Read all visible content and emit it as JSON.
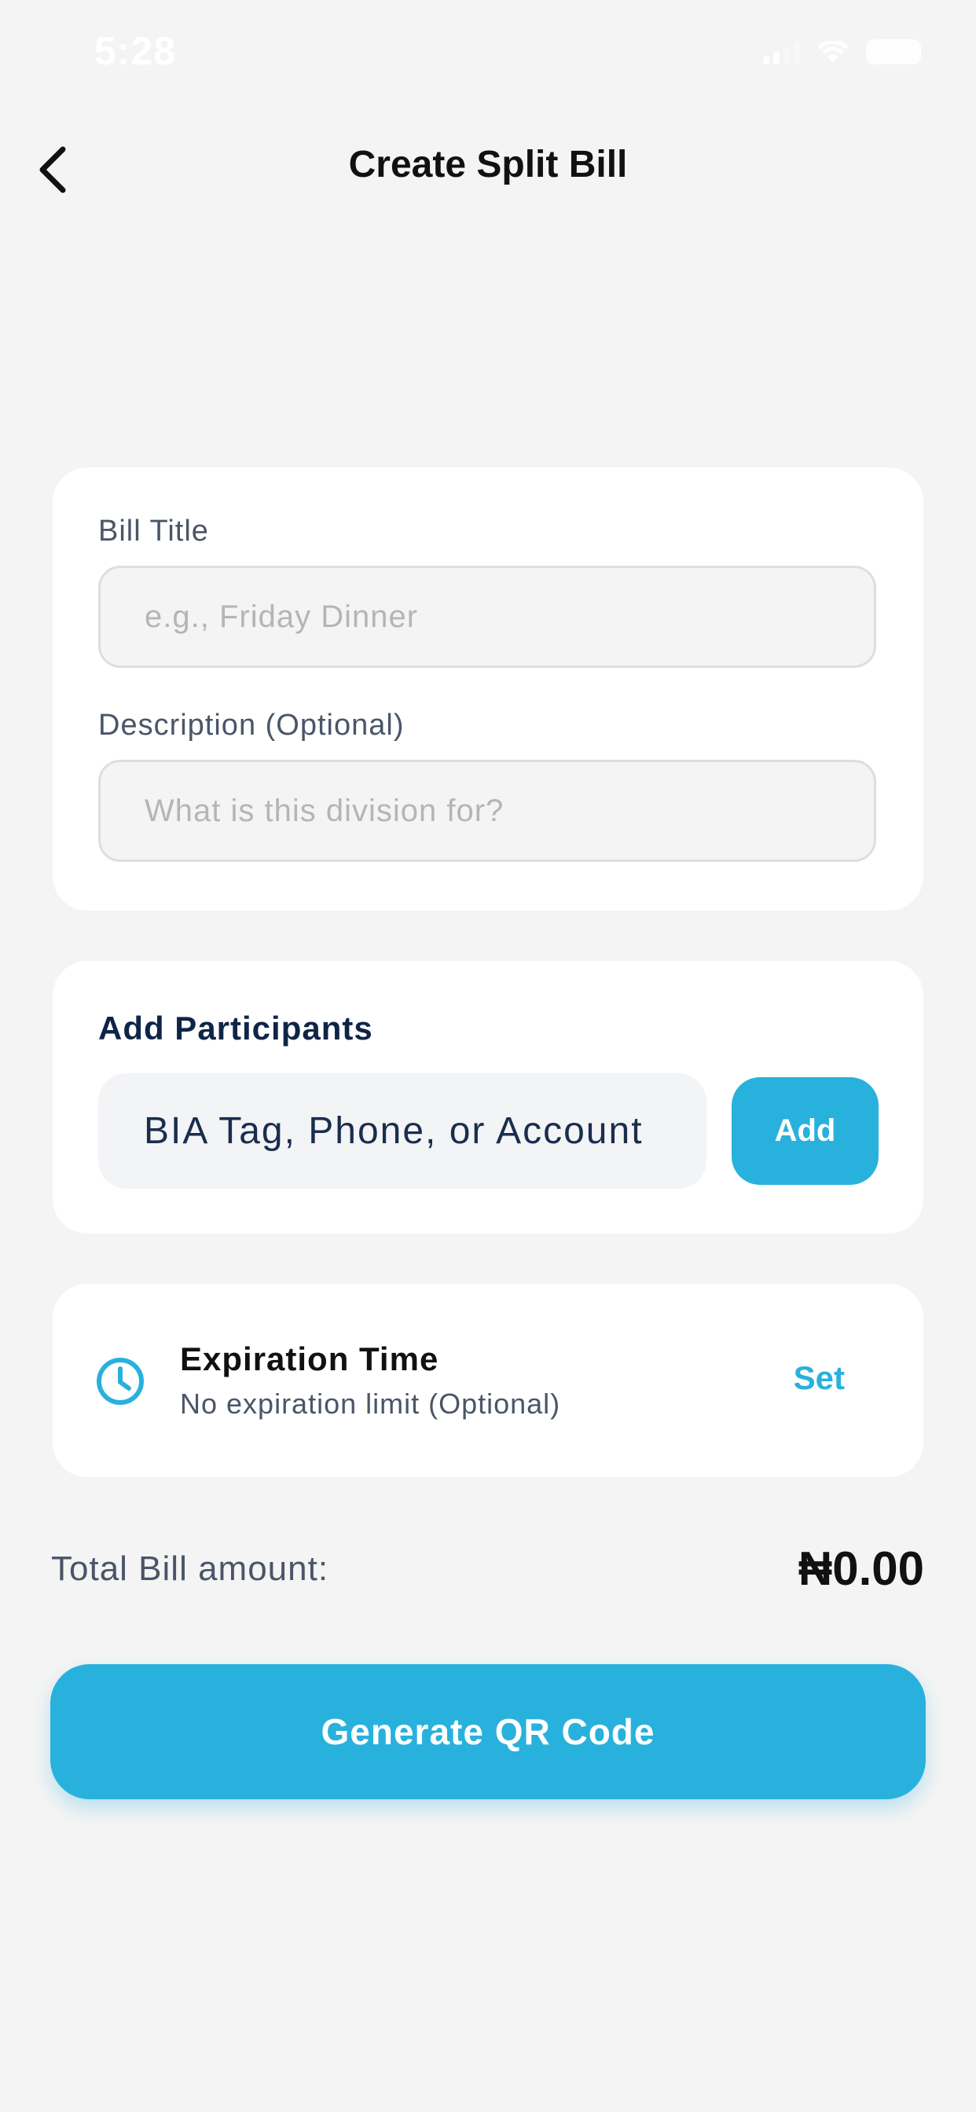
{
  "status_bar": {
    "time": "5:28"
  },
  "header": {
    "title": "Create Split Bill",
    "back_icon": "chevron-left-icon"
  },
  "details": {
    "bill_title_label": "Bill Title",
    "bill_title_placeholder": "e.g., Friday Dinner",
    "description_label": "Description (Optional)",
    "description_placeholder": "What is this division for?"
  },
  "participants": {
    "title": "Add Participants",
    "input_placeholder": "BIA Tag, Phone, or Account",
    "add_label": "Add"
  },
  "expiry": {
    "icon": "clock-icon",
    "title": "Expiration Time",
    "subtitle": "No expiration limit (Optional)",
    "set_label": "Set"
  },
  "total": {
    "label": "Total Bill amount:",
    "value": "₦0.00"
  },
  "actions": {
    "generate_label": "Generate QR Code"
  },
  "colors": {
    "accent": "#29b1dd",
    "background": "#f4f4f4",
    "card": "#ffffff",
    "navy_text": "#0f2547"
  }
}
